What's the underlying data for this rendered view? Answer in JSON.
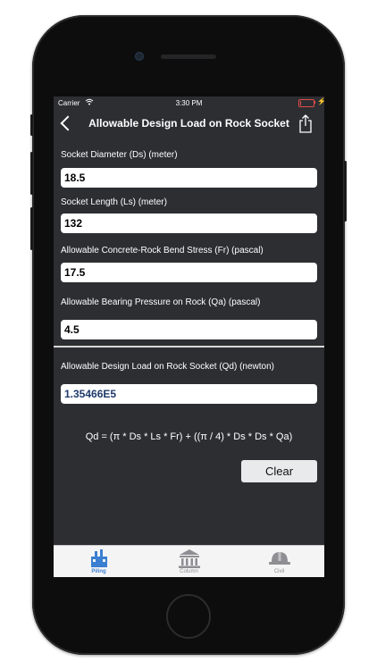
{
  "status_bar": {
    "carrier": "Carrier",
    "time": "3:30 PM",
    "wifi_icon": "wifi-icon",
    "battery_level": 0.1
  },
  "nav": {
    "title": "Allowable Design Load on Rock Socket",
    "back_icon": "chevron-left-icon",
    "share_icon": "share-icon"
  },
  "fields": [
    {
      "label": "Socket Diameter (Ds) (meter)",
      "value": "18.5"
    },
    {
      "label": "Socket Length (Ls) (meter)",
      "value": "132"
    },
    {
      "label": "Allowable Concrete-Rock Bend Stress (Fr) (pascal)",
      "value": "17.5"
    },
    {
      "label": "Allowable Bearing Pressure on Rock (Qa) (pascal)",
      "value": "4.5"
    }
  ],
  "result": {
    "label": "Allowable Design Load on Rock Socket (Qd) (newton)",
    "value": "1.35466E5"
  },
  "formula": "Qd = (π * Ds * Ls * Fr) + ((π / 4) * Ds * Ds * Qa)",
  "clear_label": "Clear",
  "tabs": [
    {
      "label": "Piling",
      "icon": "piling-icon",
      "active": true
    },
    {
      "label": "Column",
      "icon": "column-icon",
      "active": false
    },
    {
      "label": "Civil",
      "icon": "hard-hat-icon",
      "active": false
    }
  ],
  "colors": {
    "screen_background": "#2d2e32",
    "result_text": "#1f3a6b",
    "tab_active": "#3a7fd1",
    "tab_inactive": "#8e8e93"
  }
}
